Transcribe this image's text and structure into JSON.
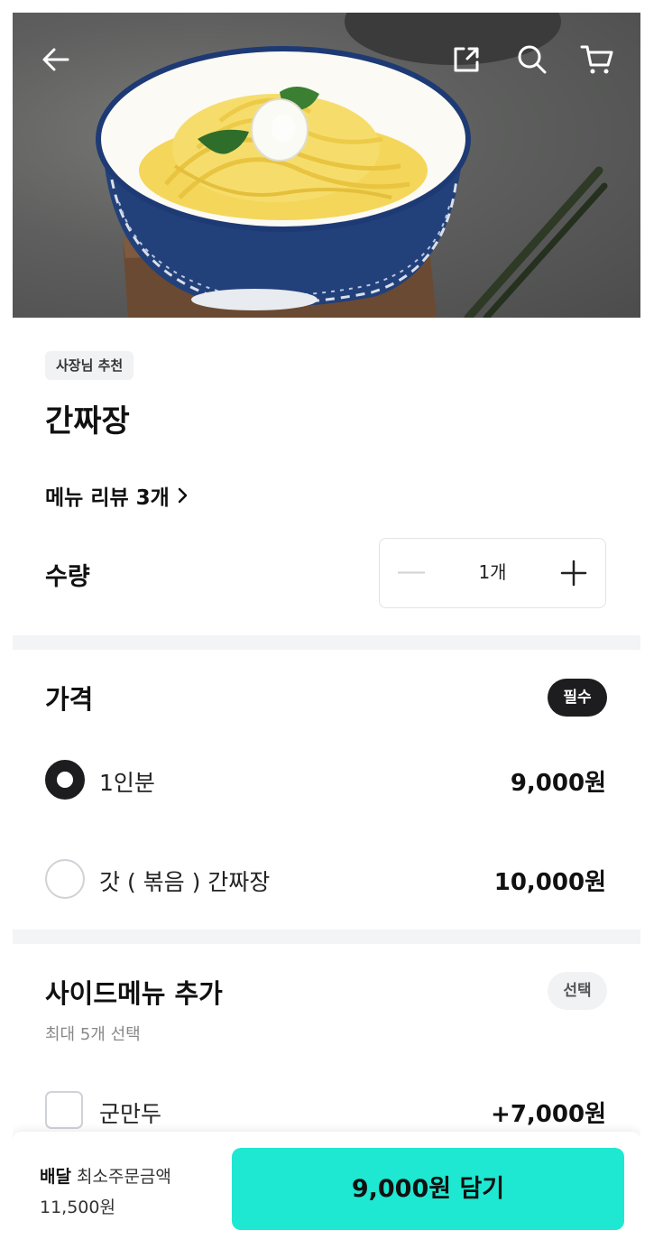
{
  "header": {
    "back_icon": "arrow-left-icon",
    "share_icon": "share-icon",
    "search_icon": "search-icon",
    "cart_icon": "cart-icon"
  },
  "menu": {
    "badge": "사장님 추천",
    "name": "간짜장",
    "review_link": "메뉴 리뷰 3개"
  },
  "quantity": {
    "label": "수량",
    "value": "1개"
  },
  "price_section": {
    "title": "가격",
    "tag": "필수",
    "options": [
      {
        "label": "1인분",
        "price": "9,000원",
        "selected": true
      },
      {
        "label": "갓 ( 볶음 ) 간짜장",
        "price": "10,000원",
        "selected": false
      }
    ]
  },
  "side_section": {
    "title": "사이드메뉴 추가",
    "tag": "선택",
    "note": "최대 5개 선택",
    "options": [
      {
        "label": "군만두",
        "price": "+7,000원",
        "checked": false
      }
    ]
  },
  "bottom": {
    "delivery_label": "배달",
    "min_order_label": "최소주문금액",
    "min_order_amount": "11,500원",
    "add_button": "9,000원 담기"
  },
  "colors": {
    "accent": "#1ee8d2",
    "dark": "#1d1d1f",
    "divider": "#f3f4f6"
  }
}
